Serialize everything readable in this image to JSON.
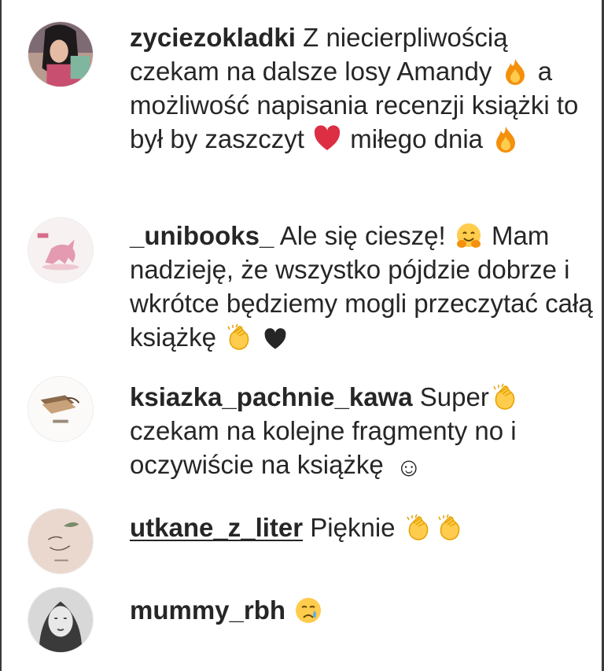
{
  "comments": [
    {
      "username": "zyciezokladki",
      "seg1": "Z niecierpliwością czekam na dalsze losy Amandy",
      "seg2": "a możliwość napisania recenzji książki to był by zaszczyt",
      "seg3": "miłego dnia",
      "emojis": [
        "fire-icon",
        "red-heart-icon",
        "fire-icon"
      ]
    },
    {
      "username": "_unibooks_",
      "seg1": "Ale się cieszę!",
      "seg2": "Mam nadzieję, że wszystko pójdzie dobrze i wkrótce będziemy mogli przeczytać całą książkę",
      "emojis": [
        "hugging-face-icon",
        "clapping-hands-icon",
        "black-heart-icon"
      ]
    },
    {
      "username": "ksiazka_pachnie_kawa",
      "seg1": "Super",
      "seg2": "czekam na kolejne fragmenty no i oczywiście na książkę",
      "seg3": "☺",
      "emojis": [
        "clapping-hands-icon"
      ]
    },
    {
      "username": "utkane_z_liter",
      "seg1": "Pięknie",
      "emojis": [
        "clapping-hands-icon",
        "clapping-hands-icon"
      ]
    },
    {
      "username": "mummy_rbh",
      "emojis": [
        "crying-face-icon"
      ]
    }
  ],
  "colors": {
    "text": "#262626",
    "fire": "#f9a825",
    "heart": "#d81b2c",
    "clap": "#ffcc33"
  }
}
